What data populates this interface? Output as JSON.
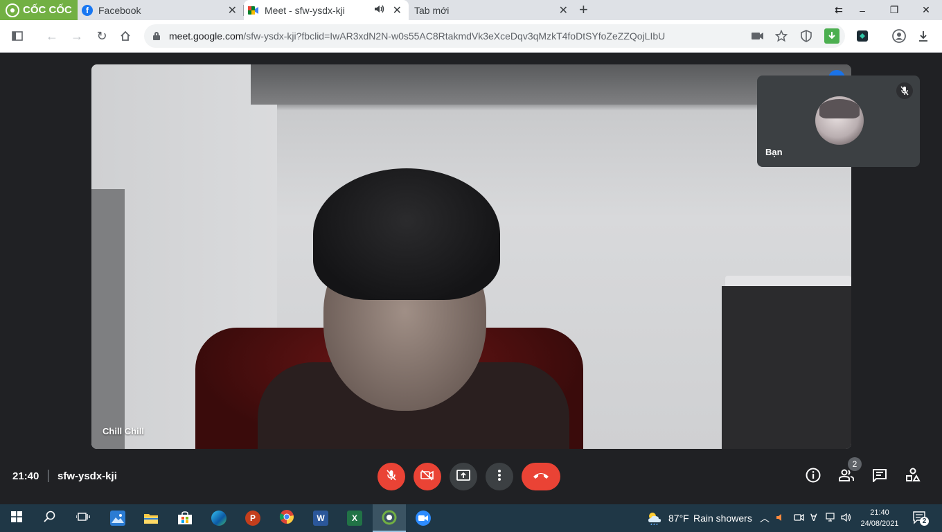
{
  "browser": {
    "brand": "CỐC CỐC",
    "tabs": [
      {
        "title": "Facebook",
        "favicon": "facebook-icon",
        "active": false
      },
      {
        "title": "Meet - sfw-ysdx-kji",
        "favicon": "google-meet-icon",
        "active": true,
        "audio": true
      },
      {
        "title": "Tab mới",
        "favicon": "",
        "active": false
      }
    ],
    "url_host": "meet.google.com",
    "url_path": "/sfw-ysdx-kji?fbclid=IwAR3xdN2N-w0s55AC8RtakmdVk3eXceDqv3qMzkT4foDtSYfoZeZZQojLIbU",
    "colors": {
      "brand_green": "#72b043",
      "tab_bg": "#dee1e6"
    }
  },
  "meet": {
    "main_participant": "Chill Chill",
    "self_tile_name": "Bạn",
    "time": "21:40",
    "meeting_code": "sfw-ysdx-kji",
    "participant_count": "2",
    "controls": [
      "mic-off",
      "camera-off",
      "present-screen",
      "more-options",
      "leave-call"
    ],
    "right_controls": [
      "meeting-details",
      "people",
      "chat",
      "activities"
    ],
    "colors": {
      "red": "#ea4335",
      "dark": "#202124",
      "tile": "#3c4043",
      "blue": "#1a73e8"
    }
  },
  "taskbar": {
    "apps": [
      "start",
      "search",
      "task-view",
      "photos",
      "file-explorer",
      "microsoft-store",
      "edge",
      "powerpoint",
      "chrome",
      "word",
      "excel",
      "coc-coc",
      "zoom"
    ],
    "weather_temp": "87°F",
    "weather_text": "Rain showers",
    "clock_time": "21:40",
    "clock_date": "24/08/2021",
    "notification_count": "2"
  }
}
